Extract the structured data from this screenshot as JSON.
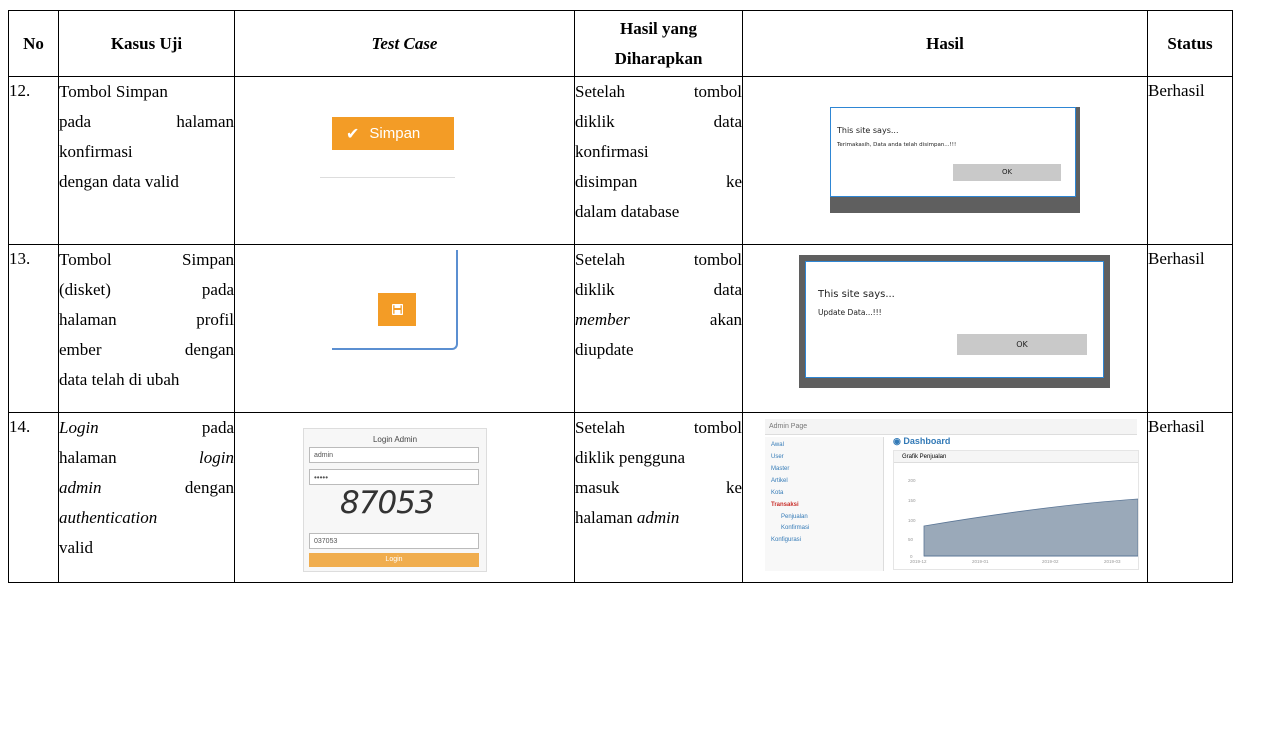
{
  "headers": [
    "No",
    "Kasus Uji",
    "Test Case",
    "Hasil yang",
    "Diharapkan",
    "Hasil",
    "Status"
  ],
  "rows": [
    {
      "no": "12.",
      "kasus": [
        "Tombol Simpan",
        "pada halaman",
        "konfirmasi",
        "dengan data valid"
      ],
      "expected": [
        "Setelah tombol",
        "diklik data",
        "konfirmasi",
        "disimpan ke",
        "dalam database"
      ],
      "status": "Berhasil",
      "test_button_label": "Simpan",
      "dialog": {
        "title": "This site says...",
        "message": "Terimakasih, Data anda telah disimpan...!!!",
        "ok": "OK"
      }
    },
    {
      "no": "13.",
      "kasus": [
        "Tombol Simpan",
        "(disket) pada",
        "halaman profil",
        "ember dengan",
        "data telah di ubah"
      ],
      "expected": [
        "Setelah tombol",
        "diklik data",
        "member akan",
        "diupdate"
      ],
      "status": "Berhasil",
      "dialog": {
        "title": "This site says...",
        "message": "Update Data...!!!",
        "ok": "OK"
      }
    },
    {
      "no": "14.",
      "kasus": [
        "Login pada",
        "halaman login",
        "admin dengan",
        "authentication",
        "valid"
      ],
      "expected": [
        "Setelah tombol",
        "diklik pengguna",
        "masuk ke",
        "halaman admin"
      ],
      "status": "Berhasil",
      "login": {
        "title": "Login Admin",
        "username": "admin",
        "password": "•••••",
        "captcha": "87053",
        "captcha_input": "037053",
        "button": "Login"
      },
      "dashboard": {
        "page_title": "Admin Page",
        "heading": "Dashboard",
        "menu": [
          "Awal",
          "User",
          "Master",
          "Artikel",
          "Kota",
          "Transaksi",
          "Penjualan",
          "Konfirmasi",
          "Konfigurasi"
        ],
        "chart_title": "Grafik Penjualan",
        "y_ticks": [
          "200",
          "150",
          "100",
          "50",
          "0"
        ],
        "x_ticks": [
          "2019-12",
          "2019-01",
          "2019-02",
          "2019-03"
        ]
      }
    }
  ]
}
